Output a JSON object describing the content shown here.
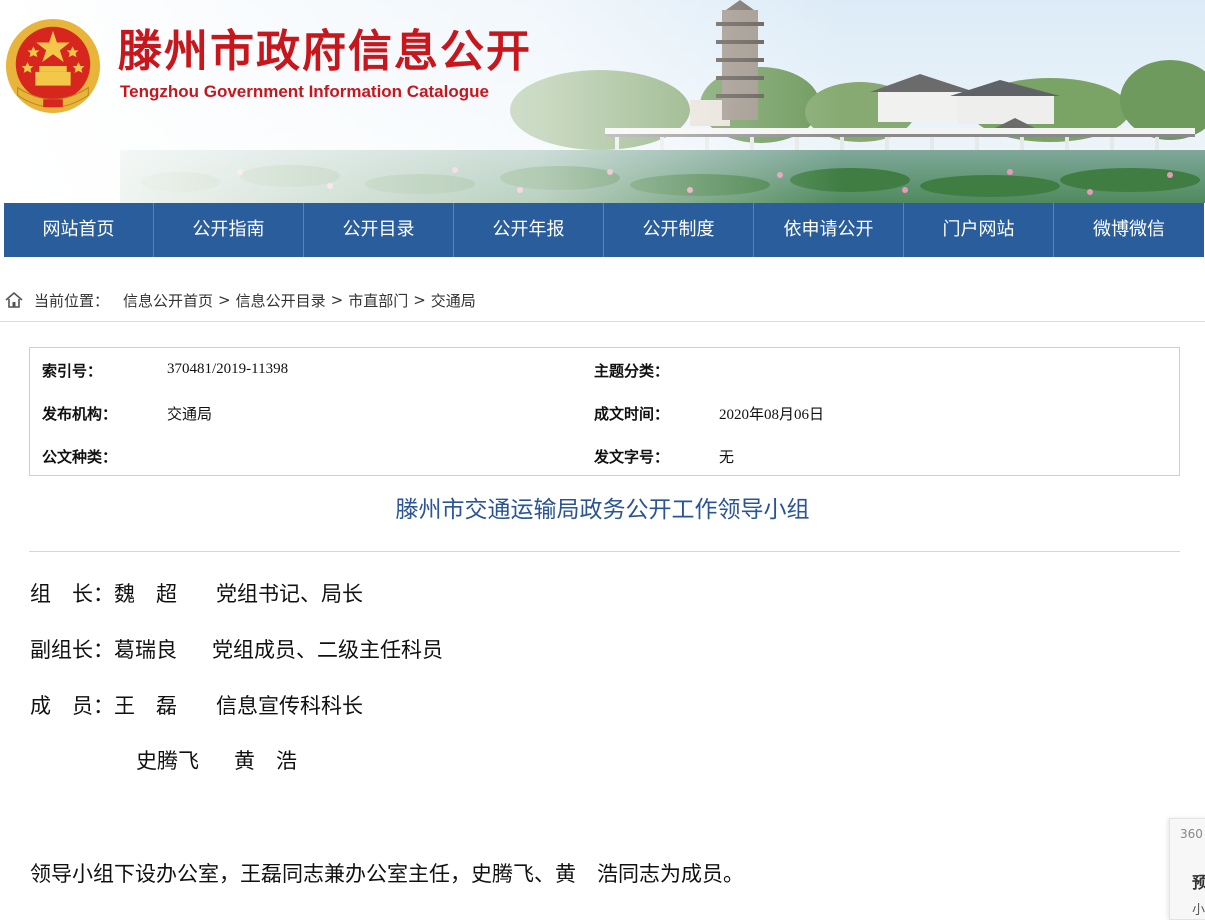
{
  "header": {
    "title": "滕州市政府信息公开",
    "subtitle": "Tengzhou Government Information Catalogue"
  },
  "nav": {
    "items": [
      "网站首页",
      "公开指南",
      "公开目录",
      "公开年报",
      "公开制度",
      "依申请公开",
      "门户网站",
      "微博微信"
    ]
  },
  "breadcrumb": {
    "prefix": "当前位置：",
    "items": [
      "信息公开首页",
      "信息公开目录",
      "市直部门",
      "交通局"
    ],
    "separator": ">"
  },
  "meta": {
    "index_label": "索引号：",
    "index_value": "370481/2019-11398",
    "topic_label": "主题分类：",
    "topic_value": "",
    "publisher_label": "发布机构：",
    "publisher_value": "交通局",
    "date_label": "成文时间：",
    "date_value": "2020年08月06日",
    "doctype_label": "公文种类：",
    "doctype_value": "",
    "docno_label": "发文字号：",
    "docno_value": "无"
  },
  "article": {
    "title": "滕州市交通运输局政务公开工作领导小组",
    "members": [
      {
        "role": "组　长：",
        "name": "魏　超",
        "post": "党组书记、局长"
      },
      {
        "role": "副组长：",
        "name": "葛瑞良",
        "post": "党组成员、二级主任科员"
      },
      {
        "role": "成　员：",
        "name": "王　磊",
        "post": "信息宣传科科长"
      },
      {
        "role": "",
        "name": "史腾飞",
        "post": "黄　浩"
      }
    ],
    "paragraph": "领导小组下设办公室，王磊同志兼办公室主任，史腾飞、黄　浩同志为成员。"
  },
  "side_widget": {
    "tag": "360",
    "heading": "预",
    "sub": "小"
  },
  "colors": {
    "brand_red": "#c8161d",
    "nav_blue": "#2a5d9c",
    "title_blue": "#2a5496"
  }
}
